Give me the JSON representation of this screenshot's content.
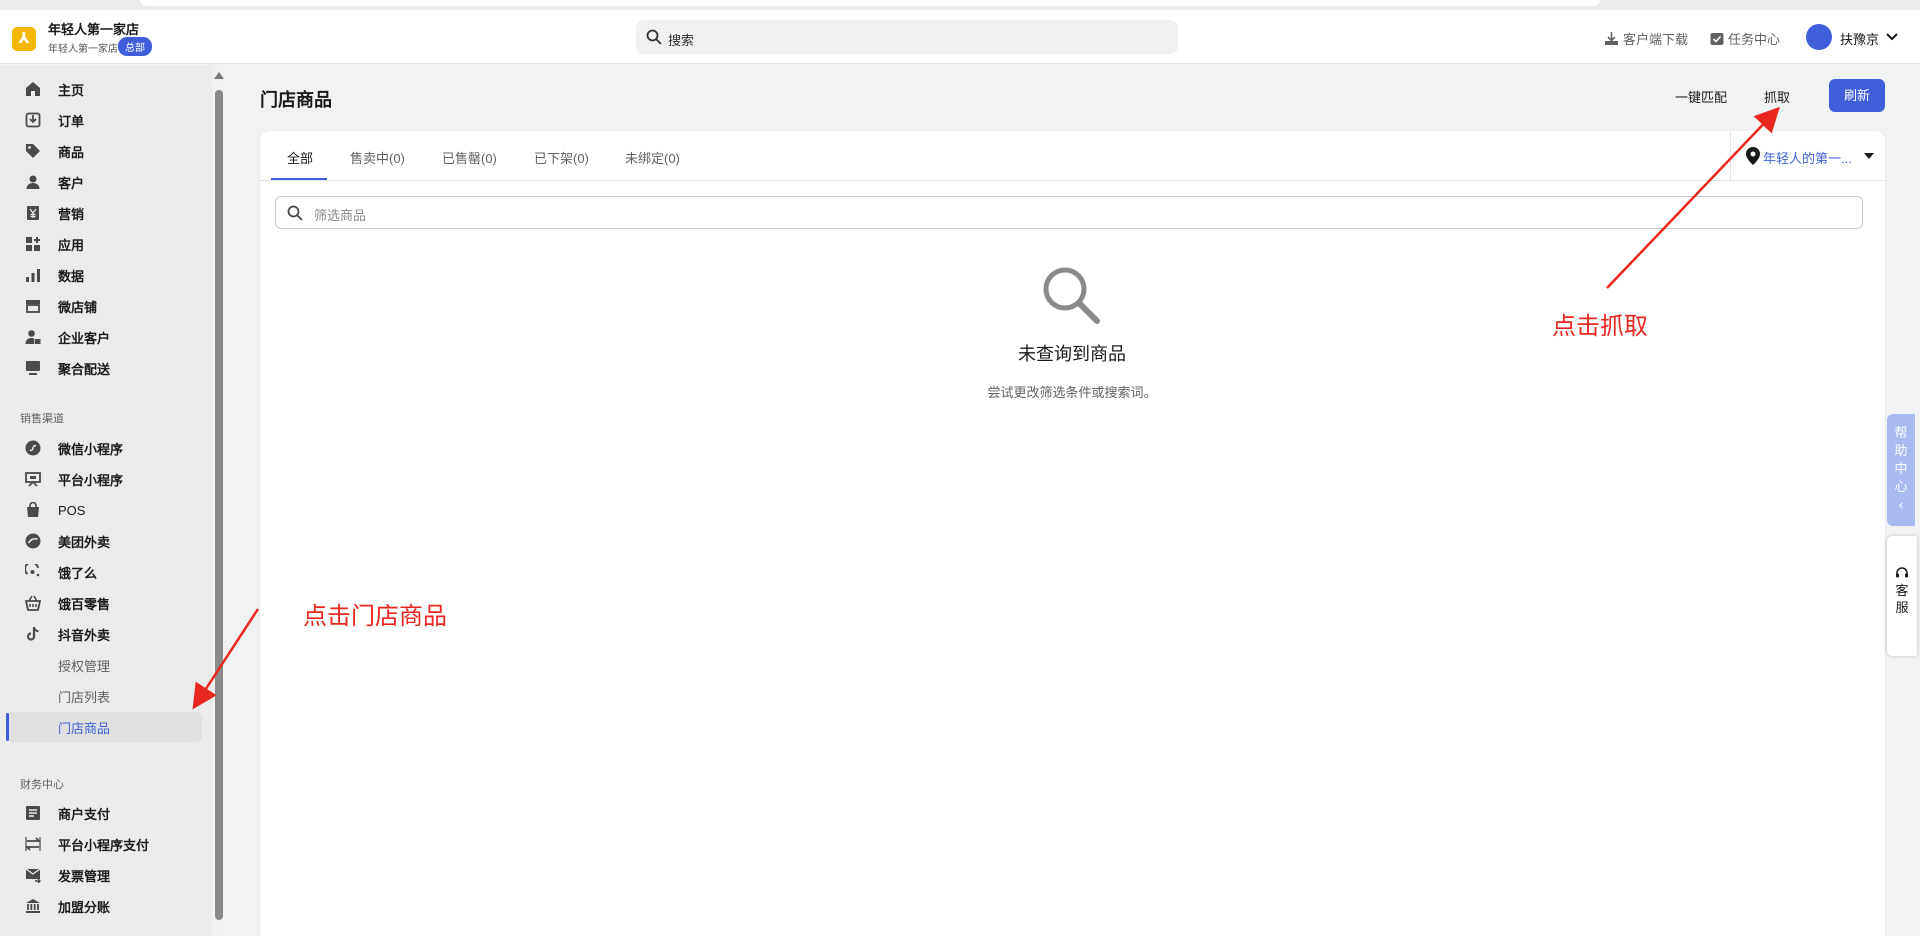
{
  "header": {
    "store_name": "年轻人第一家店",
    "store_sub": "年轻人第一家店",
    "hq_badge": "总部",
    "search_placeholder": "搜索",
    "client_download": "客户端下载",
    "task_center": "任务中心",
    "user_name": "扶豫京"
  },
  "sidebar": {
    "items": [
      {
        "label": "主页",
        "icon": "home-icon"
      },
      {
        "label": "订单",
        "icon": "order-icon"
      },
      {
        "label": "商品",
        "icon": "tag-icon"
      },
      {
        "label": "客户",
        "icon": "person-icon"
      },
      {
        "label": "营销",
        "icon": "yen-icon"
      },
      {
        "label": "应用",
        "icon": "apps-icon"
      },
      {
        "label": "数据",
        "icon": "bar-chart-icon"
      },
      {
        "label": "微店铺",
        "icon": "shop-icon"
      },
      {
        "label": "企业客户",
        "icon": "enterprise-user-icon"
      },
      {
        "label": "聚合配送",
        "icon": "monitor-icon"
      }
    ],
    "sales_channel_label": "销售渠道",
    "channels": [
      {
        "label": "微信小程序",
        "icon": "mini-program-icon"
      },
      {
        "label": "平台小程序",
        "icon": "platform-icon"
      },
      {
        "label": "POS",
        "icon": "pos-bag-icon"
      },
      {
        "label": "美团外卖",
        "icon": "meituan-icon"
      },
      {
        "label": "饿了么",
        "icon": "eleme-icon"
      },
      {
        "label": "饿百零售",
        "icon": "basket-icon"
      },
      {
        "label": "抖音外卖",
        "icon": "tiktok-icon"
      }
    ],
    "sub_items": [
      "授权管理",
      "门店列表",
      "门店商品"
    ],
    "finance_label": "财务中心",
    "finance": [
      {
        "label": "商户支付",
        "icon": "document-icon"
      },
      {
        "label": "平台小程序支付",
        "icon": "transfer-icon"
      },
      {
        "label": "发票管理",
        "icon": "invoice-mail-icon"
      },
      {
        "label": "加盟分账",
        "icon": "bank-icon"
      }
    ]
  },
  "main": {
    "title": "门店商品",
    "actions": {
      "match": "一键匹配",
      "fetch": "抓取",
      "refresh": "刷新"
    },
    "tabs": [
      "全部",
      "售卖中(0)",
      "已售罄(0)",
      "已下架(0)",
      "未绑定(0)"
    ],
    "store_selector": "年轻人的第一...",
    "filter_placeholder": "筛选商品",
    "empty_title": "未查询到商品",
    "empty_sub": "尝试更改筛选条件或搜索词。"
  },
  "annotations": {
    "fetch": "点击抓取",
    "store_products": "点击门店商品"
  },
  "float": {
    "help": [
      "帮",
      "助",
      "中",
      "心",
      "‹"
    ],
    "service": [
      "客",
      "服"
    ]
  },
  "colors": {
    "accent": "#3e5fd9",
    "annotation": "#e8271e",
    "logo": "#f5b800"
  }
}
